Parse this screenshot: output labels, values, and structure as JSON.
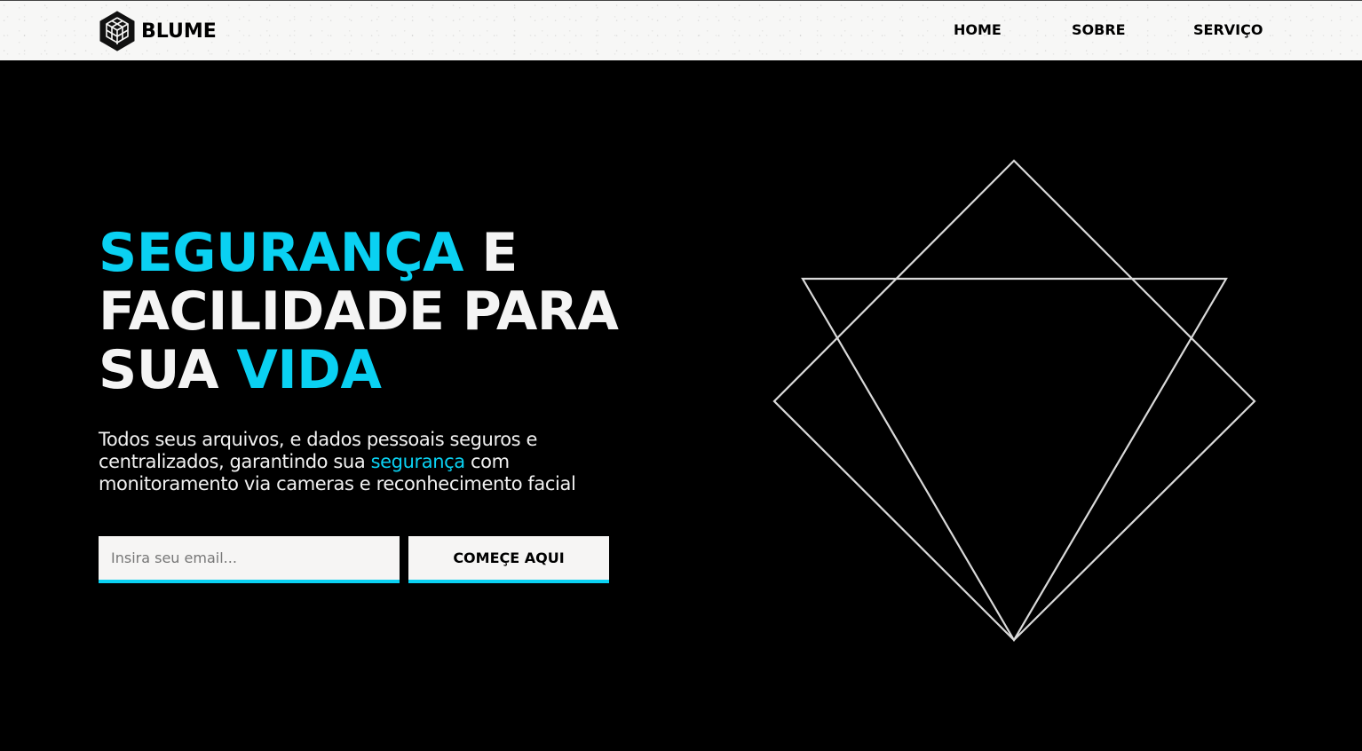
{
  "header": {
    "brand": "BLUME",
    "nav": [
      {
        "label": "HOME"
      },
      {
        "label": "SOBRE"
      },
      {
        "label": "SERVIÇO"
      }
    ]
  },
  "hero": {
    "title_accent_1": "SEGURANÇA",
    "title_text_1": " E",
    "title_line_2": "FACILIDADE PARA",
    "title_text_3": "SUA ",
    "title_accent_3": "VIDA",
    "description_line_1": "Todos seus arquivos, e dados pessoais seguros e",
    "description_line_2_start": "centralizados, garantindo sua ",
    "description_line_2_accent": "segurança",
    "description_line_2_end": " com",
    "description_line_3": "monitoramento via cameras e reconhecimento facial",
    "email_placeholder": "Insira seu email...",
    "email_value": "",
    "cta_label": "COMEÇE AQUI"
  },
  "colors": {
    "accent": "#0ad1f2",
    "background": "#000000",
    "header_background": "#f7f7f6",
    "text_light": "#f4f4f4"
  },
  "icons": {
    "brand": "hexagon-cube-icon",
    "illustration": "geometric-triangles-illustration"
  }
}
